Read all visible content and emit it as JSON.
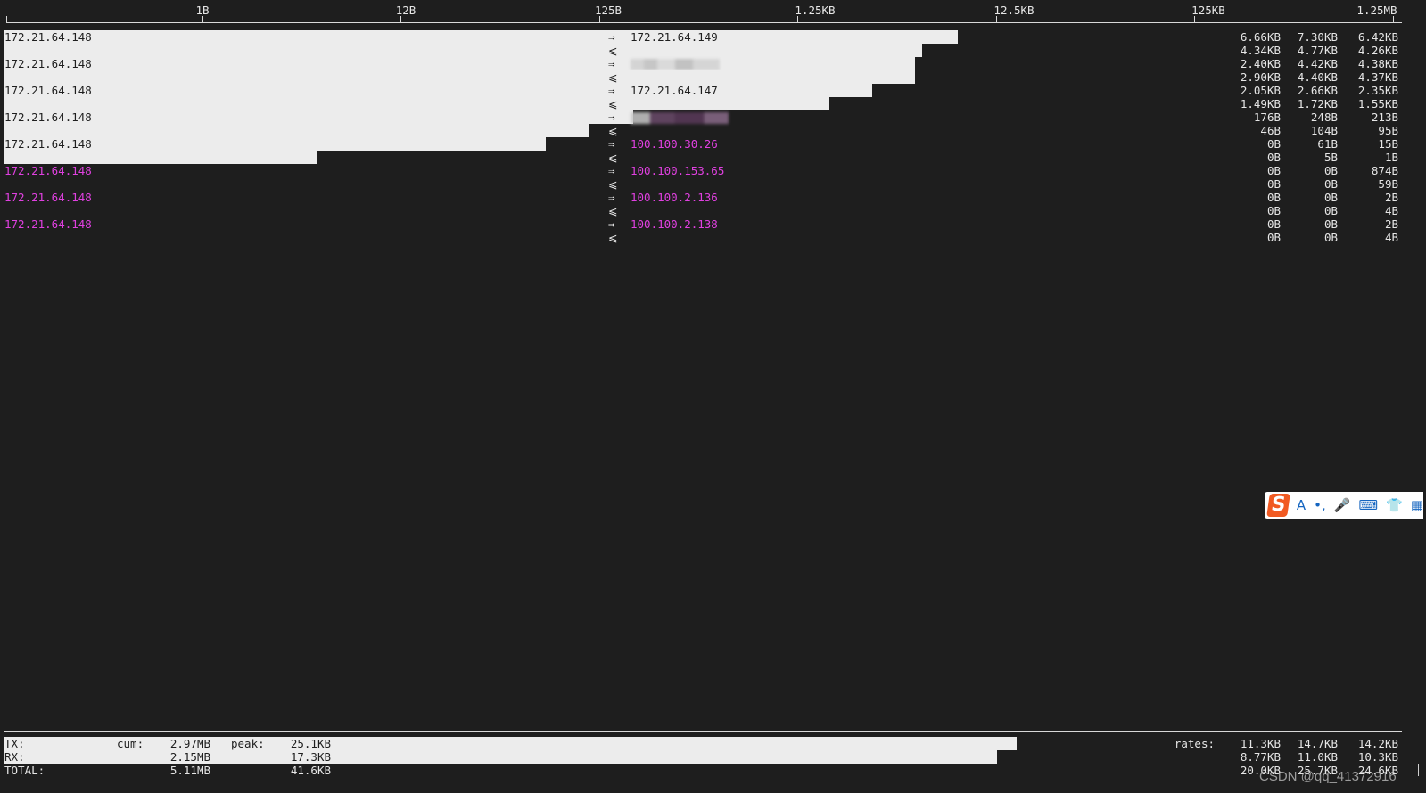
{
  "scale": {
    "ticks": [
      "1B",
      "12B",
      "125B",
      "1.25KB",
      "12.5KB",
      "125KB",
      "1.25MB"
    ]
  },
  "connections": [
    {
      "src": "172.21.64.148",
      "dst": "172.21.64.149",
      "dst_redacted": false,
      "highlight": false,
      "tx": [
        "6.66KB",
        "7.30KB",
        "6.42KB"
      ],
      "rx": [
        "4.34KB",
        "4.77KB",
        "4.26KB"
      ]
    },
    {
      "src": "172.21.64.148",
      "dst": "",
      "dst_redacted": true,
      "highlight": false,
      "tx": [
        "2.40KB",
        "4.42KB",
        "4.38KB"
      ],
      "rx": [
        "2.90KB",
        "4.40KB",
        "4.37KB"
      ]
    },
    {
      "src": "172.21.64.148",
      "dst": "172.21.64.147",
      "dst_redacted": false,
      "highlight": false,
      "tx": [
        "2.05KB",
        "2.66KB",
        "2.35KB"
      ],
      "rx": [
        "1.49KB",
        "1.72KB",
        "1.55KB"
      ]
    },
    {
      "src": "172.21.64.148",
      "dst": "",
      "dst_redacted": true,
      "highlight": false,
      "tx": [
        "176B",
        "248B",
        "213B"
      ],
      "rx": [
        "46B",
        "104B",
        "95B"
      ]
    },
    {
      "src": "172.21.64.148",
      "dst": "100.100.30.26",
      "dst_redacted": false,
      "highlight": false,
      "tx": [
        "0B",
        "61B",
        "15B"
      ],
      "rx": [
        "0B",
        "5B",
        "1B"
      ]
    },
    {
      "src": "172.21.64.148",
      "dst": "100.100.153.65",
      "dst_redacted": false,
      "highlight": true,
      "tx": [
        "0B",
        "0B",
        "874B"
      ],
      "rx": [
        "0B",
        "0B",
        "59B"
      ]
    },
    {
      "src": "172.21.64.148",
      "dst": "100.100.2.136",
      "dst_redacted": false,
      "highlight": true,
      "tx": [
        "0B",
        "0B",
        "2B"
      ],
      "rx": [
        "0B",
        "0B",
        "4B"
      ]
    },
    {
      "src": "172.21.64.148",
      "dst": "100.100.2.138",
      "dst_redacted": false,
      "highlight": true,
      "tx": [
        "0B",
        "0B",
        "2B"
      ],
      "rx": [
        "0B",
        "0B",
        "4B"
      ]
    }
  ],
  "arrows": {
    "out": "⇒",
    "in": "⩽"
  },
  "totals": {
    "labels": {
      "tx": "TX:",
      "rx": "RX:",
      "total": "TOTAL:",
      "cum": "cum:",
      "peak": "peak:",
      "rates": "rates:"
    },
    "tx": {
      "cum": "2.97MB",
      "peak": "25.1KB",
      "rates": [
        "11.3KB",
        "14.7KB",
        "14.2KB"
      ]
    },
    "rx": {
      "cum": "2.15MB",
      "peak": "17.3KB",
      "rates": [
        "8.77KB",
        "11.0KB",
        "10.3KB"
      ]
    },
    "total": {
      "cum": "5.11MB",
      "peak": "41.6KB",
      "rates": [
        "20.0KB",
        "25.7KB",
        "24.6KB"
      ]
    }
  },
  "ime_toolbar": {
    "logo": "S",
    "items": [
      {
        "icon": "font-a-icon",
        "glyph": "A"
      },
      {
        "icon": "punctuation-icon",
        "glyph": "•,"
      },
      {
        "icon": "microphone-icon",
        "glyph": "🎤"
      },
      {
        "icon": "keyboard-icon",
        "glyph": "⌨"
      },
      {
        "icon": "shirt-skin-icon",
        "glyph": "👕"
      },
      {
        "icon": "grid-apps-icon",
        "glyph": "▦"
      }
    ]
  },
  "watermark": "CSDN @qq_41372916",
  "colors": {
    "background": "#1e1e1e",
    "bar": "#ececec",
    "highlight": "#e040e0"
  }
}
